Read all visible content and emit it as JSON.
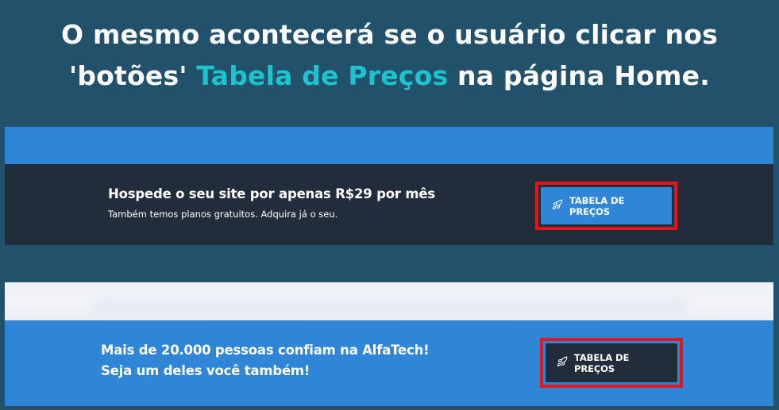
{
  "headline": {
    "part1": "O mesmo acontecerá se o usuário clicar nos",
    "part2_prefix": "'botões' ",
    "part2_highlight": "Tabela de Preços",
    "part2_suffix": " na página Home."
  },
  "colors": {
    "background": "#22516b",
    "highlight_text": "#1ec3d0",
    "brand_blue": "#2f86d6",
    "dark_section": "#212d3b",
    "highlight_border": "#e8141d"
  },
  "cta1": {
    "title": "Hospede o seu site por apenas R$29 por mês",
    "subtitle": "Também temos planos gratuitos. Adquira já o seu.",
    "button_label": "TABELA DE PREÇOS",
    "button_icon": "rocket-icon"
  },
  "cta2": {
    "line1": "Mais de 20.000 pessoas confiam na AlfaTech!",
    "line2": "Seja um deles você também!",
    "button_label": "TABELA DE PREÇOS",
    "button_icon": "rocket-icon"
  }
}
